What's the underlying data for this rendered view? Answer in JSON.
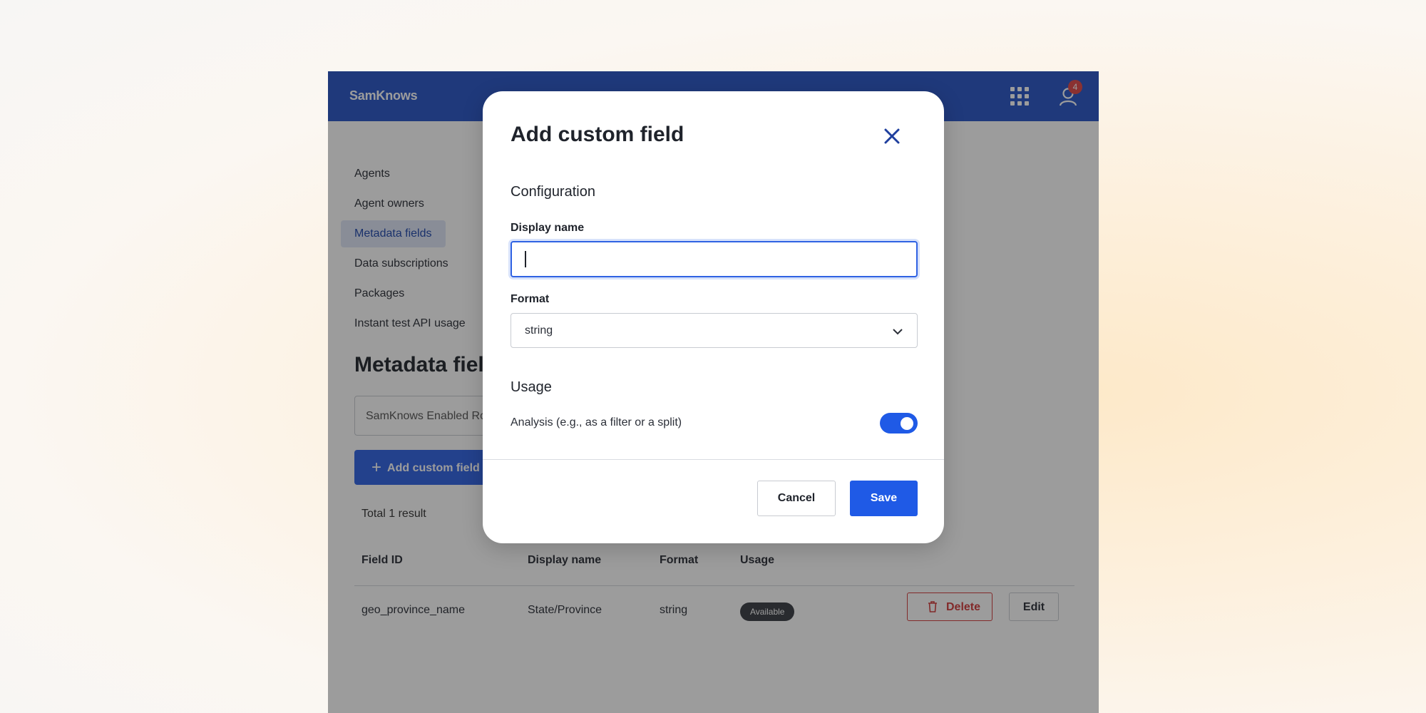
{
  "app": {
    "brand": "SamKnows",
    "notification_count": "4"
  },
  "sidebar": {
    "items": [
      {
        "label": "Agents"
      },
      {
        "label": "Agent owners"
      },
      {
        "label": "Metadata fields",
        "active": true
      },
      {
        "label": "Data subscriptions"
      },
      {
        "label": "Packages"
      },
      {
        "label": "Instant test API usage"
      }
    ]
  },
  "main": {
    "title": "Metadata fields",
    "filter_value": "SamKnows Enabled Routers",
    "add_button_label": "Add custom field",
    "total_text": "Total 1 result",
    "table": {
      "headers": [
        "Field ID",
        "Display name",
        "Format",
        "Usage"
      ],
      "rows": [
        {
          "field_id": "geo_province_name",
          "display_name": "State/Province",
          "format": "string",
          "usage": "Available"
        }
      ],
      "delete_label": "Delete",
      "edit_label": "Edit"
    }
  },
  "modal": {
    "title": "Add custom field",
    "configuration_heading": "Configuration",
    "display_name_label": "Display name",
    "display_name_value": "",
    "format_label": "Format",
    "format_value": "string",
    "usage_heading": "Usage",
    "analysis_label": "Analysis (e.g., as a filter or a split)",
    "analysis_enabled": true,
    "cancel_label": "Cancel",
    "save_label": "Save"
  },
  "colors": {
    "topbar": "#2855c7",
    "primary": "#1f5ae6",
    "danger": "#d23b3b",
    "close_icon": "#1f3f9e"
  }
}
